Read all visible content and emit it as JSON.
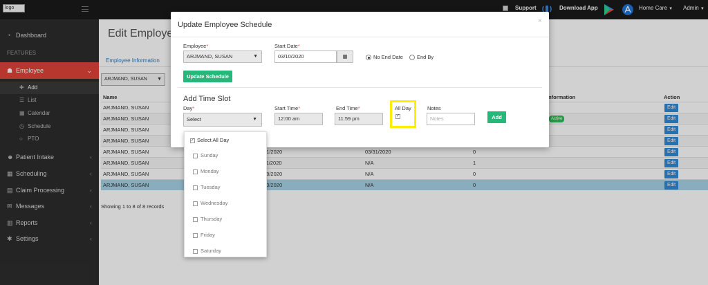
{
  "topbar": {
    "logo_alt": "logo",
    "support": "Support",
    "download_app": "Download App",
    "org": "Home Care",
    "user": "Admin"
  },
  "sidebar": {
    "dashboard": "Dashboard",
    "features_heading": "FEATURES",
    "employee": "Employee",
    "sub_items": [
      "Add",
      "List",
      "Calendar",
      "Schedule",
      "PTO"
    ],
    "items": [
      "Patient Intake",
      "Scheduling",
      "Claim Processing",
      "Messages",
      "Reports",
      "Settings"
    ]
  },
  "main": {
    "title": "Edit Employee -",
    "tab": "Employee Information",
    "employee_select": "ARJMAND, SUSAN",
    "columns": {
      "name": "Name",
      "information": "Information",
      "action": "Action"
    },
    "rows": [
      {
        "name": "ARJMAND, SUSAN",
        "c2": "",
        "c3": "",
        "c4": "",
        "badge": "",
        "sel": false
      },
      {
        "name": "ARJMAND, SUSAN",
        "c2": "",
        "c3": "",
        "c4": "",
        "badge": "Active",
        "sel": false
      },
      {
        "name": "ARJMAND, SUSAN",
        "c2": "",
        "c3": "",
        "c4": "",
        "badge": "",
        "sel": false
      },
      {
        "name": "ARJMAND, SUSAN",
        "c2": "",
        "c3": "",
        "c4": "",
        "badge": "",
        "sel": false
      },
      {
        "name": "ARJMAND, SUSAN",
        "c2": "01/2020",
        "c3": "03/31/2020",
        "c4": "0",
        "badge": "",
        "sel": false
      },
      {
        "name": "ARJMAND, SUSAN",
        "c2": "11/2020",
        "c3": "N/A",
        "c4": "1",
        "badge": "",
        "sel": false
      },
      {
        "name": "ARJMAND, SUSAN",
        "c2": "08/2020",
        "c3": "N/A",
        "c4": "0",
        "badge": "",
        "sel": false
      },
      {
        "name": "ARJMAND, SUSAN",
        "c2": "10/2020",
        "c3": "N/A",
        "c4": "0",
        "badge": "",
        "sel": true
      }
    ],
    "edit_label": "Edit",
    "showing": "Showing 1 to 8 of 8 records"
  },
  "modal": {
    "title": "Update Employee Schedule",
    "close": "×",
    "employee_label": "Employee",
    "employee_value": "ARJMAND, SUSAN",
    "start_date_label": "Start Date",
    "start_date_value": "03/10/2020",
    "no_end_date": "No End Date",
    "end_by": "End By",
    "update_button": "Update Schedule",
    "time_slot_title": "Add Time Slot",
    "day_label": "Day",
    "day_value": "Select",
    "start_time_label": "Start Time",
    "start_time_value": "12:00 am",
    "end_time_label": "End Time",
    "end_time_value": "11:59 pm",
    "all_day_label": "All Day",
    "notes_label": "Notes",
    "notes_placeholder": "Notes",
    "add_button": "Add",
    "required_mark": "*"
  },
  "day_dropdown": {
    "select_all": "Select All Day",
    "days": [
      "Sunday",
      "Monday",
      "Tuesday",
      "Wednesday",
      "Thursday",
      "Friday",
      "Saturday"
    ]
  },
  "colors": {
    "active_red": "#e0443a",
    "green": "#26b77a",
    "edit_blue": "#2e8ad8",
    "highlight_yellow": "#ffee00",
    "selected_row": "#a6d4e6"
  }
}
